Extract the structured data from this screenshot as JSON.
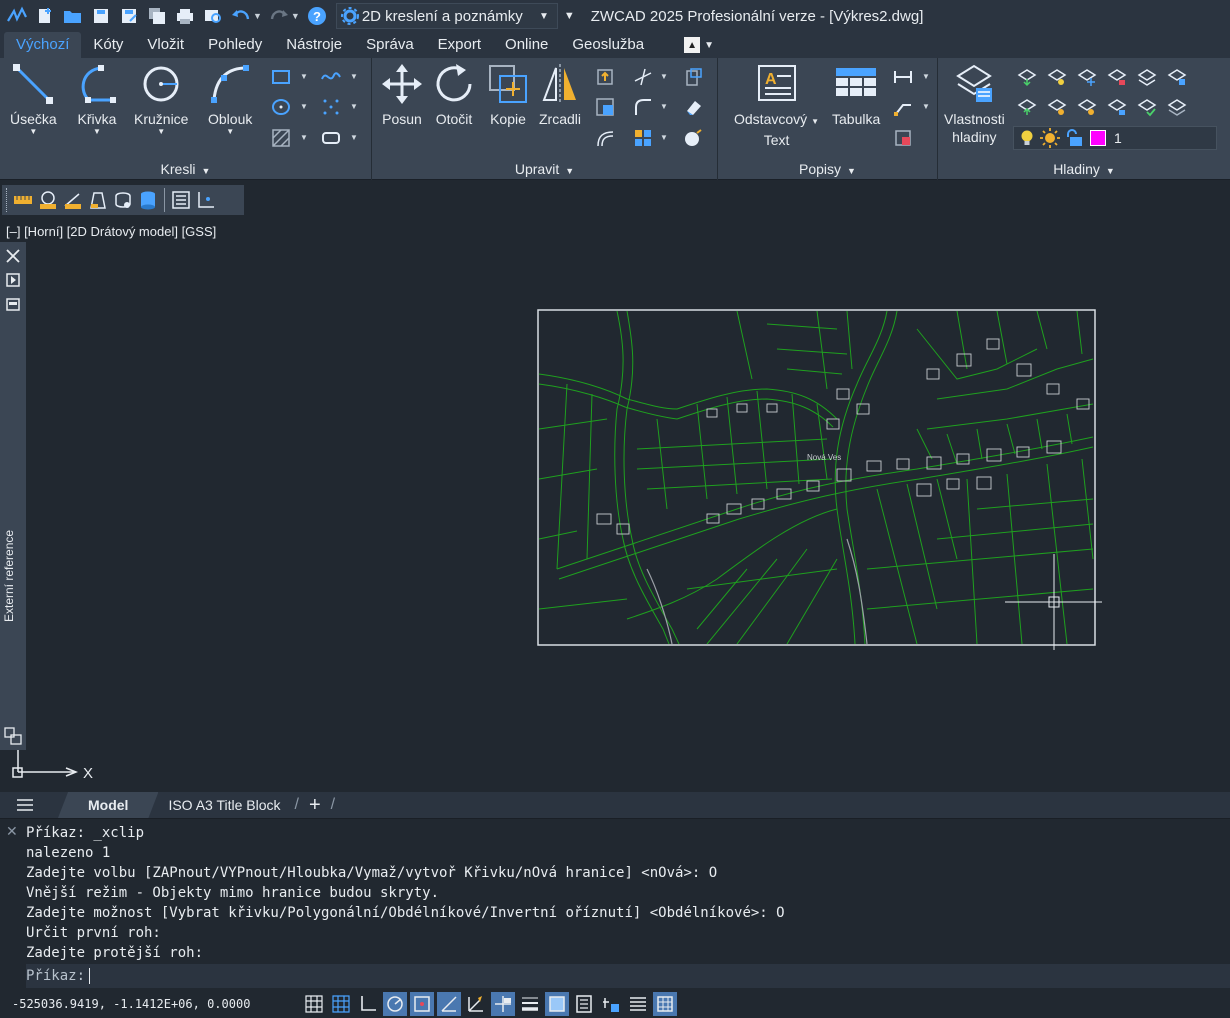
{
  "titlebar": {
    "workspace": "2D kreslení a poznámky",
    "title": "ZWCAD 2025 Profesionální verze - [Výkres2.dwg]"
  },
  "tabs": [
    "Výchozí",
    "Kóty",
    "Vložit",
    "Pohledy",
    "Nástroje",
    "Správa",
    "Export",
    "Online",
    "Geoslužba"
  ],
  "ribbon": {
    "kresli": {
      "title": "Kresli",
      "buttons": [
        "Úsečka",
        "Křivka",
        "Kružnice",
        "Oblouk"
      ]
    },
    "upravit": {
      "title": "Upravit",
      "buttons": [
        "Posun",
        "Otočit",
        "Kopie",
        "Zrcadli"
      ]
    },
    "popisy": {
      "title": "Popisy",
      "text_line1": "Odstavcový",
      "text_line2": "Text",
      "table": "Tabulka"
    },
    "hladiny": {
      "title": "Hladiny",
      "props_line1": "Vlastnosti",
      "props_line2": "hladiny",
      "current_layer": "1",
      "current_layer_color": "#ff00ff"
    }
  },
  "viewport": {
    "label": "[–] [Horní] [2D Drátový model] [GSS]",
    "xref_title": "Externí reference",
    "drawing_label": "Nová Ves",
    "ucs_x": "X",
    "line_color": "#1fa01f",
    "background_color": "#212830"
  },
  "layout_tabs": {
    "model": "Model",
    "layout1": "ISO A3 Title Block",
    "add": "+"
  },
  "command": {
    "history": [
      "Příkaz: _xclip",
      "nalezeno 1",
      "Zadejte volbu [ZAPnout/VYPnout/Hloubka/Vymaž/vytvoř Křivku/nOvá hranice] <nOvá>: O",
      "Vnější režim - Objekty mimo hranice budou skryty.",
      "Zadejte možnost [Vybrat křivku/Polygonální/Obdélníkové/Invertní oříznutí] <Obdélníkové>: O",
      "Určit první roh:",
      "Zadejte protější roh:"
    ],
    "prompt": "Příkaz:"
  },
  "status": {
    "coords": "-525036.9419, -1.1412E+06, 0.0000"
  }
}
